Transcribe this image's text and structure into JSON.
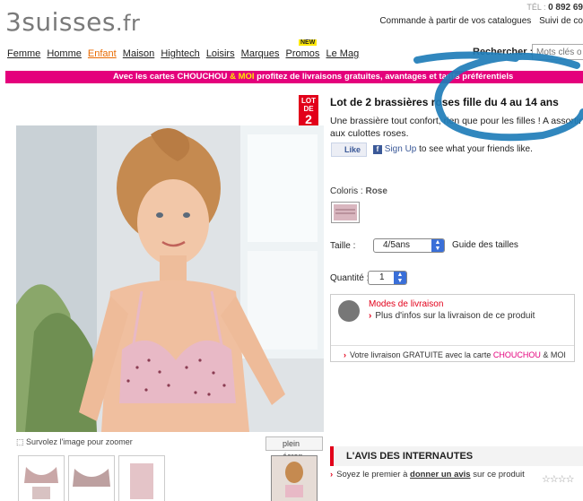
{
  "header": {
    "logo_main": "3suisses",
    "logo_suffix": ".fr",
    "phone_prefix": "TÉL :",
    "phone_number": "0 892 69",
    "links": [
      "Commande à partir de vos catalogues",
      "Suivi de co"
    ]
  },
  "nav": {
    "items": [
      "Femme",
      "Homme",
      "Enfant",
      "Maison",
      "Hightech",
      "Loisirs",
      "Marques",
      "Promos",
      "Le Mag"
    ],
    "active": "Enfant",
    "badge": "NEW"
  },
  "search": {
    "label": "Rechercher :",
    "placeholder": "Mots clés ou"
  },
  "promo": {
    "before": "Avec les cartes CHOUCHOU",
    "amp": "& MOI",
    "after": " profitez de livraisons gratuites, avantages et tarifs préférentiels"
  },
  "product": {
    "lot_badge_top": "LOT DE",
    "lot_badge_num": "2",
    "title": "Lot de 2 brassières roses fille du 4 au 14 ans",
    "description": "Une brassière tout confort, rien que pour les filles ! A assortir aux culottes roses.",
    "zoom_hint": "Survolez l'image pour zoomer",
    "fullscreen": "plein écran"
  },
  "social": {
    "like_label": "Like",
    "signup_link": "Sign Up",
    "signup_text": " to see what your friends like."
  },
  "options": {
    "colors_label": "Coloris :",
    "color_value": "Rose",
    "size_label": "Taille :",
    "size_value": "4/5ans",
    "size_guide": "Guide des tailles",
    "qty_label": "Quantité :",
    "qty_value": "1"
  },
  "delivery": {
    "title": "Modes de livraison",
    "info": "Plus d'infos sur la livraison de ce produit",
    "free_before": "Votre livraison GRATUITE avec la carte ",
    "free_brand": "CHOUCHOU",
    "free_after": " & MOI"
  },
  "reviews": {
    "heading": "L'AVIS DES INTERNAUTES",
    "prefix": "Soyez le premier à ",
    "link": "donner un avis",
    "suffix": " sur ce produit",
    "stars": "☆☆☆☆"
  },
  "colors": {
    "brand_pink": "#e4007c",
    "brand_red": "#e2001a",
    "active_nav": "#e86a00",
    "annotation_blue": "#1f7db8"
  }
}
